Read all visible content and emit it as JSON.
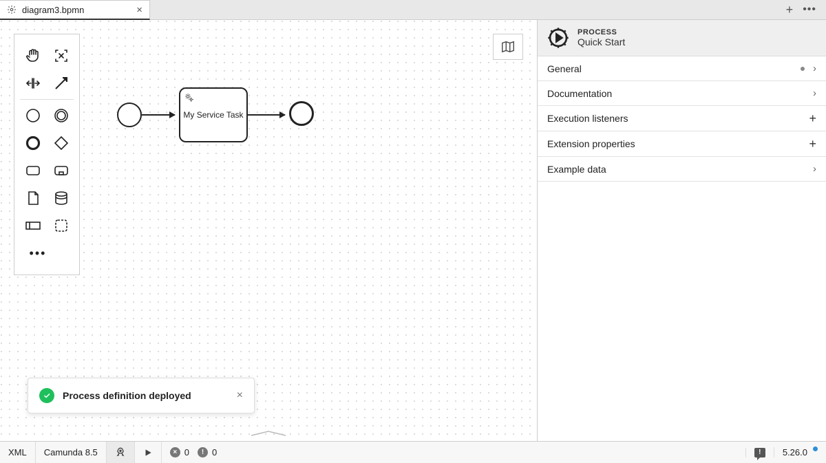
{
  "tab": {
    "title": "diagram3.bpmn"
  },
  "diagram": {
    "task_label": "My Service Task"
  },
  "notification": {
    "message": "Process definition deployed"
  },
  "properties": {
    "header_label": "PROCESS",
    "header_value": "Quick Start",
    "sections": {
      "general": "General",
      "documentation": "Documentation",
      "execution_listeners": "Execution listeners",
      "extension_properties": "Extension properties",
      "example_data": "Example data"
    }
  },
  "statusbar": {
    "xml": "XML",
    "platform": "Camunda 8.5",
    "errors": "0",
    "warnings": "0",
    "version": "5.26.0",
    "feedback_glyph": "!"
  }
}
